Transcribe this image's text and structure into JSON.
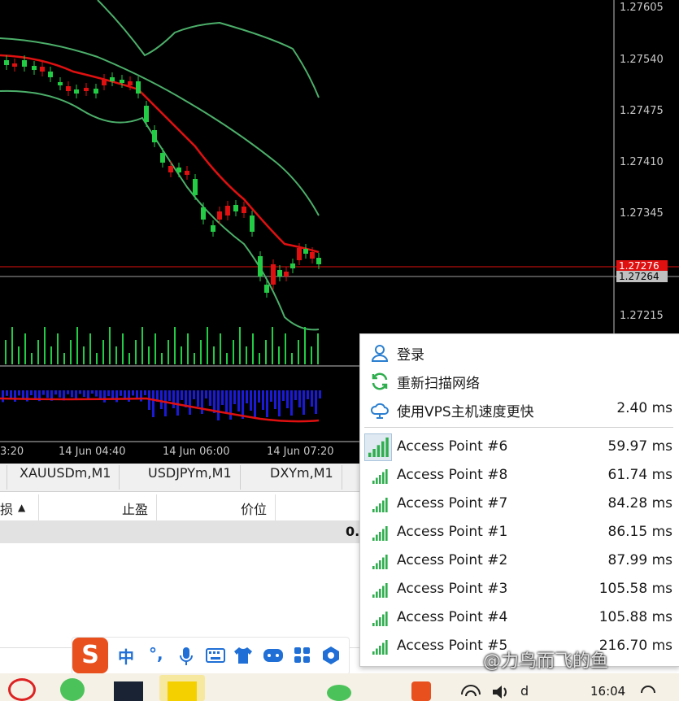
{
  "chart": {
    "price_labels": [
      "1.27605",
      "1.27540",
      "1.27475",
      "1.27410",
      "1.27345",
      "1.27215"
    ],
    "bid_label": "1.27276",
    "ask_label": "1.27264",
    "time_labels": [
      "3:20",
      "14 Jun 04:40",
      "14 Jun 06:00",
      "14 Jun 07:20"
    ],
    "colors": {
      "background": "#000000",
      "bull": "#22cc44",
      "bear": "#e01010",
      "bands": "#4caf6a",
      "ma": "#e01010",
      "macd_hist": "#1a1ad8"
    }
  },
  "tabs": [
    "XAUUSDm,M1",
    "USDJPYm,M1",
    "DXYm,M1"
  ],
  "table": {
    "headers": [
      "损",
      "止盈",
      "价位"
    ],
    "sort_indicator": "▲",
    "gray_value": "0."
  },
  "menu": {
    "items": [
      {
        "icon": "user-icon",
        "label": "登录"
      },
      {
        "icon": "refresh-icon",
        "label": "重新扫描网络"
      },
      {
        "icon": "cloud-icon",
        "label": "使用VPS主机速度更快",
        "value": "2.40 ms"
      }
    ],
    "access_points": [
      {
        "label": "Access Point #6",
        "value": "59.97 ms",
        "selected": true
      },
      {
        "label": "Access Point #8",
        "value": "61.74 ms"
      },
      {
        "label": "Access Point #7",
        "value": "84.28 ms"
      },
      {
        "label": "Access Point #1",
        "value": "86.15 ms"
      },
      {
        "label": "Access Point #2",
        "value": "87.99 ms"
      },
      {
        "label": "Access Point #3",
        "value": "105.58 ms"
      },
      {
        "label": "Access Point #4",
        "value": "105.88 ms"
      },
      {
        "label": "Access Point #5",
        "value": "216.70 ms"
      }
    ]
  },
  "ime": {
    "logo": "S",
    "items": [
      "中",
      "°,",
      "mic-icon",
      "keyboard-icon",
      "shirt-icon",
      "gamepad-icon",
      "apps-icon",
      "settings-icon"
    ]
  },
  "watermark": "@力鸟而飞的鱼",
  "taskbar": {
    "time": "16:04",
    "extra": "d"
  }
}
